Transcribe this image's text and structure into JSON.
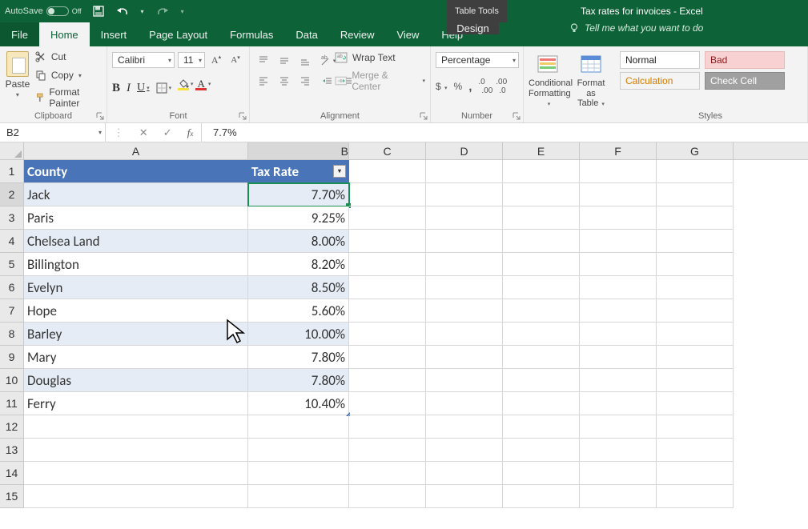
{
  "titlebar": {
    "autosave_label": "AutoSave",
    "autosave_state": "Off",
    "doc_title": "Tax rates for invoices  -  Excel",
    "contextual_tool": "Table Tools"
  },
  "tabs": {
    "file": "File",
    "home": "Home",
    "insert": "Insert",
    "page_layout": "Page Layout",
    "formulas": "Formulas",
    "data": "Data",
    "review": "Review",
    "view": "View",
    "help": "Help",
    "design": "Design",
    "tellme": "Tell me what you want to do"
  },
  "ribbon": {
    "clipboard": {
      "label": "Clipboard",
      "paste": "Paste",
      "cut": "Cut",
      "copy": "Copy",
      "format_painter": "Format Painter"
    },
    "font": {
      "label": "Font",
      "name": "Calibri",
      "size": "11"
    },
    "alignment": {
      "label": "Alignment",
      "wrap": "Wrap Text",
      "merge": "Merge & Center"
    },
    "number": {
      "label": "Number",
      "format": "Percentage"
    },
    "cond": {
      "cond_label": "Conditional",
      "cond_label2": "Formatting",
      "table_label": "Format as",
      "table_label2": "Table"
    },
    "styles": {
      "label": "Styles",
      "normal": "Normal",
      "bad": "Bad",
      "calc": "Calculation",
      "check": "Check Cell"
    }
  },
  "formula_bar": {
    "name_box": "B2",
    "value": "7.7%"
  },
  "columns": [
    "A",
    "B",
    "C",
    "D",
    "E",
    "F",
    "G"
  ],
  "table": {
    "headers": {
      "county": "County",
      "tax_rate": "Tax Rate"
    },
    "rows": [
      {
        "county": "Jack",
        "tax_rate": "7.70%"
      },
      {
        "county": "Paris",
        "tax_rate": "9.25%"
      },
      {
        "county": "Chelsea Land",
        "tax_rate": "8.00%"
      },
      {
        "county": "Billington",
        "tax_rate": "8.20%"
      },
      {
        "county": "Evelyn",
        "tax_rate": "8.50%"
      },
      {
        "county": "Hope",
        "tax_rate": "5.60%"
      },
      {
        "county": "Barley",
        "tax_rate": "10.00%"
      },
      {
        "county": "Mary",
        "tax_rate": "7.80%"
      },
      {
        "county": "Douglas",
        "tax_rate": "7.80%"
      },
      {
        "county": "Ferry",
        "tax_rate": "10.40%"
      }
    ]
  },
  "row_numbers": [
    "1",
    "2",
    "3",
    "4",
    "5",
    "6",
    "7",
    "8",
    "9",
    "10",
    "11",
    "12",
    "13",
    "14",
    "15"
  ],
  "active_cell": "B2"
}
